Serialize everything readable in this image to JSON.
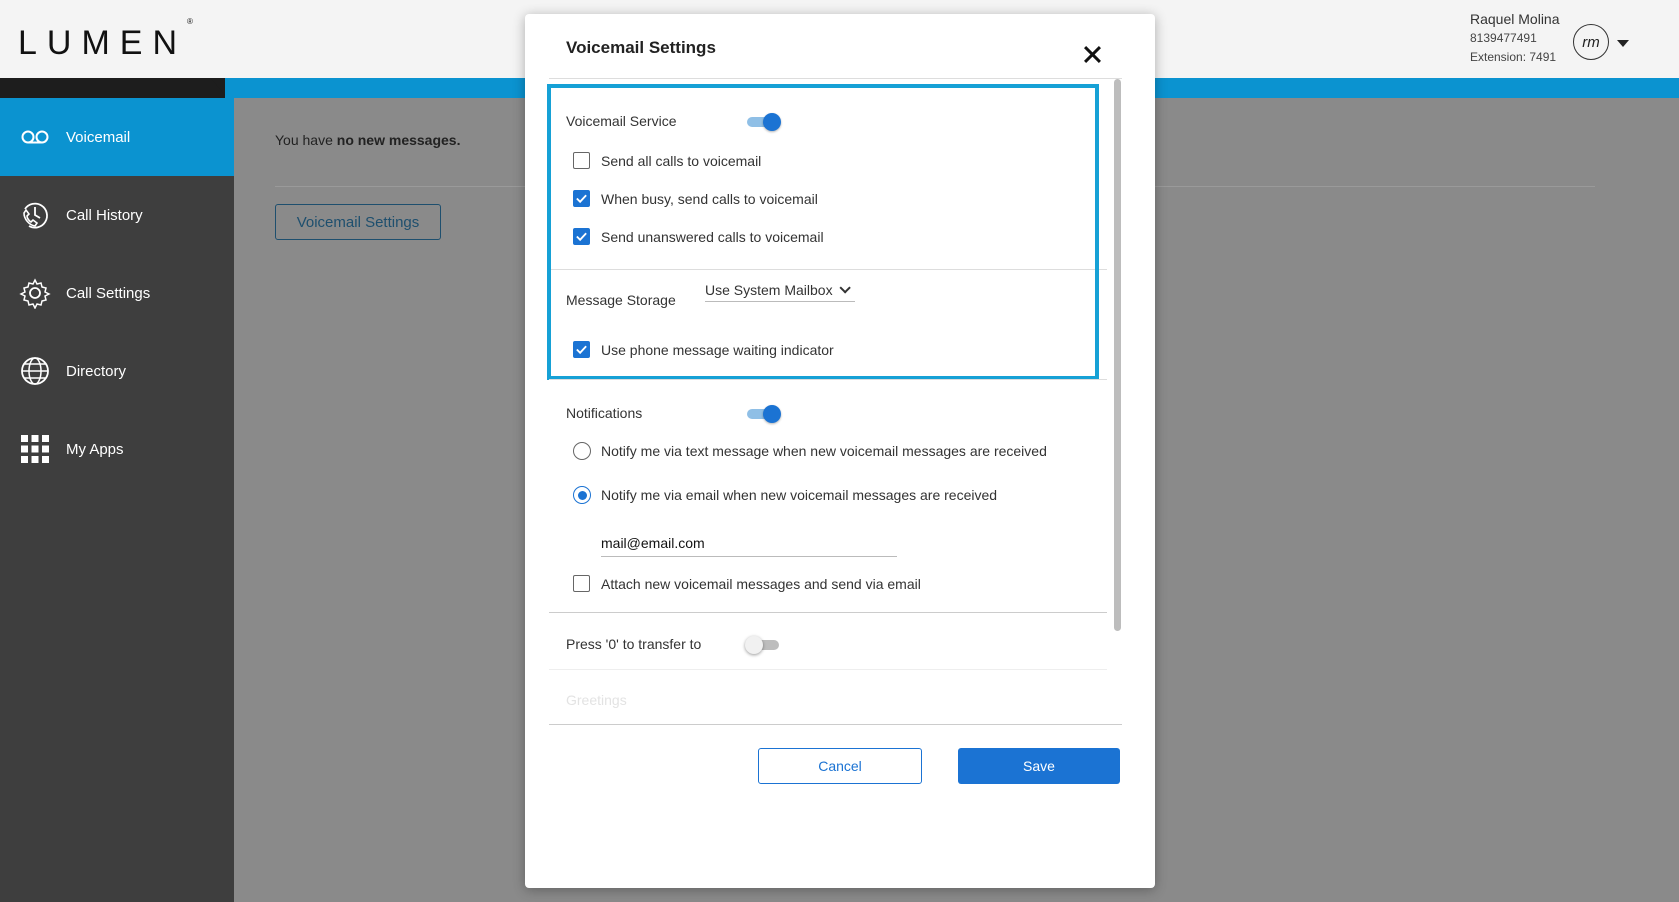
{
  "app": {
    "logo_text": "LUMEN",
    "logo_mark": "®"
  },
  "user": {
    "name": "Raquel Molina",
    "phone": "8139477491",
    "extension": "Extension: 7491",
    "initials": "rm"
  },
  "sidebar": {
    "items": [
      {
        "label": "Voicemail",
        "icon": "voicemail-icon",
        "active": true
      },
      {
        "label": "Call History",
        "icon": "call-history-icon",
        "active": false
      },
      {
        "label": "Call Settings",
        "icon": "gear-icon",
        "active": false
      },
      {
        "label": "Directory",
        "icon": "globe-icon",
        "active": false
      },
      {
        "label": "My Apps",
        "icon": "apps-grid-icon",
        "active": false
      }
    ]
  },
  "main": {
    "message_prefix": "You have ",
    "message_bold": "no new messages.",
    "settings_button": "Voicemail Settings"
  },
  "modal": {
    "title": "Voicemail Settings",
    "voicemail_service": {
      "label": "Voicemail Service",
      "enabled": true,
      "options": [
        {
          "label": "Send all calls to voicemail",
          "checked": false
        },
        {
          "label": "When busy, send calls to voicemail",
          "checked": true
        },
        {
          "label": "Send unanswered calls to voicemail",
          "checked": true
        }
      ]
    },
    "message_storage": {
      "label": "Message Storage",
      "selected": "Use System Mailbox",
      "mwi_label": "Use phone message waiting indicator",
      "mwi_checked": true
    },
    "notifications": {
      "label": "Notifications",
      "enabled": true,
      "text_option": "Notify me via text message when new voicemail messages are received",
      "email_option": "Notify me via email when new voicemail messages are received",
      "email_value": "mail@email.com",
      "attach_label": "Attach new voicemail messages and send via email",
      "attach_checked": false
    },
    "transfer": {
      "label": "Press '0' to transfer to",
      "enabled": false
    },
    "greetings_label": "Greetings",
    "cancel_label": "Cancel",
    "save_label": "Save"
  },
  "colors": {
    "accent": "#1b73d3",
    "highlight": "#16a1d6",
    "sidebar": "#3e3e3e",
    "stripe": "#0b93d0"
  }
}
